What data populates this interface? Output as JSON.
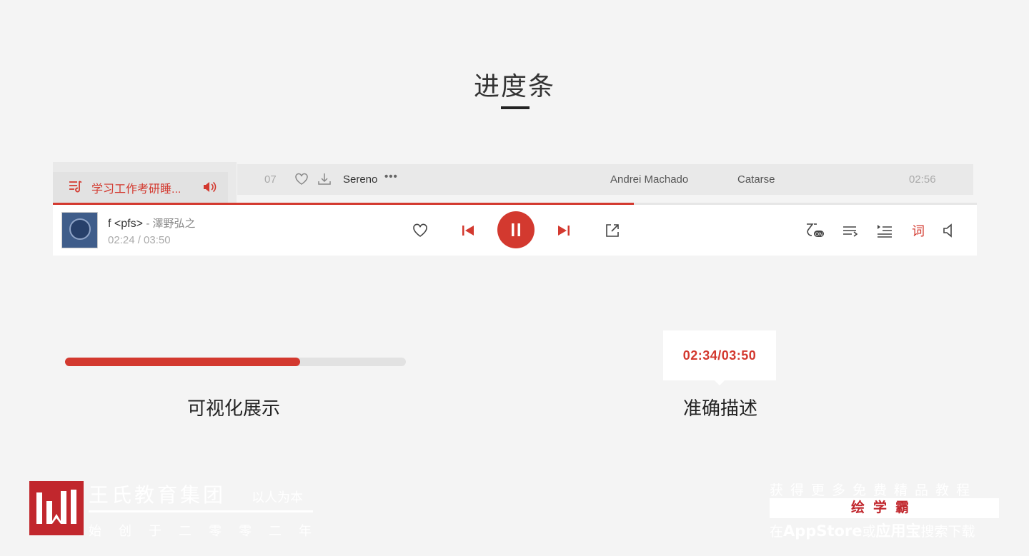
{
  "page": {
    "title": "进度条"
  },
  "playlist": {
    "active_item": "学习工作考研睡..."
  },
  "track_row": {
    "number": "07",
    "title": "Sereno",
    "more": "•••",
    "artist": "Andrei Machado",
    "album": "Catarse",
    "duration": "02:56"
  },
  "player": {
    "progress_fraction": 0.629,
    "song_title": "f <pfs>",
    "song_artist": "- 澤野弘之",
    "current_time": "02:24 /",
    "total_time": "03:50",
    "lyric_button": "词"
  },
  "demo": {
    "progress_fraction": 0.69,
    "caption_left": "可视化展示",
    "tooltip_time": "02:34/03:50",
    "caption_right": "准确描述"
  },
  "footer": {
    "org_name": "王氏教育集团",
    "slogan": "以人为本",
    "founded": "始创于二零零二年",
    "promo_top": "获得更多免费精品教程",
    "promo_brand": "绘学霸",
    "promo_bottom_prefix": "在",
    "promo_bottom_store1": "AppStore",
    "promo_bottom_mid": "或",
    "promo_bottom_store2": "应用宝",
    "promo_bottom_suffix": "搜索下载"
  },
  "colors": {
    "accent": "#d3392f",
    "background": "#f4f4f4",
    "logo": "#c1272d"
  }
}
